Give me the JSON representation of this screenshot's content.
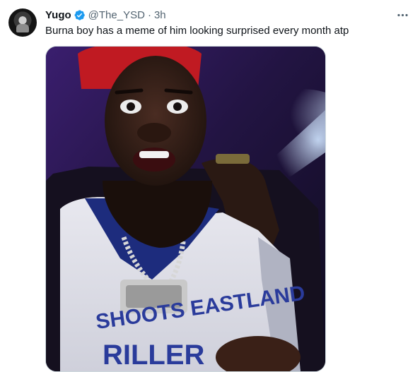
{
  "tweet": {
    "author_name": "Yugo",
    "handle": "@The_YSD",
    "separator": "·",
    "time": "3h",
    "text": "Burna boy has a meme of him looking surprised every month atp",
    "verified_color": "#1d9bf0",
    "media": {
      "alt": "Jersey text: SHOOTS EASTLAND RILLER",
      "jersey_text_top": "SHOOTS EASTLAND",
      "jersey_text_bottom": "RILLER"
    }
  },
  "icons": {
    "verified": "verified-badge-icon",
    "more": "more-options-icon"
  }
}
